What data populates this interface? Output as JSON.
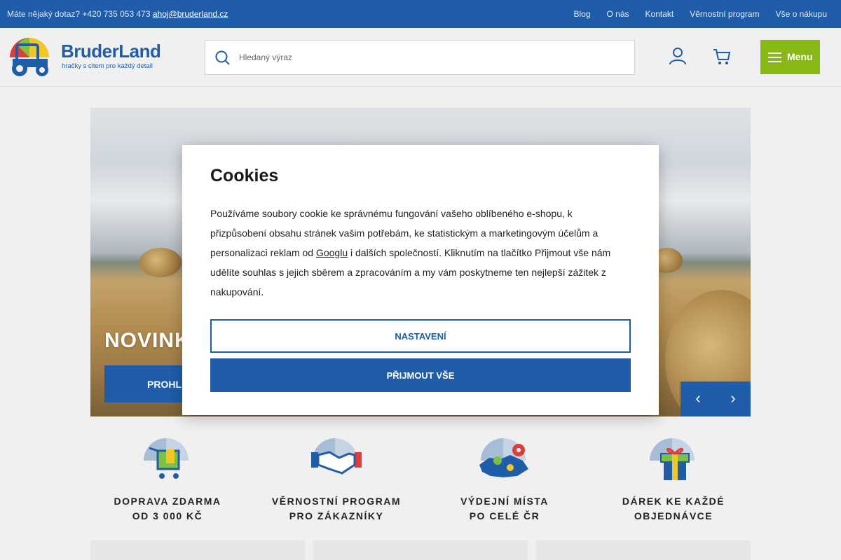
{
  "topbar": {
    "contact_text": "Máte nějaký dotaz? +420 735 053 473",
    "email": "ahoj@bruderland.cz",
    "links": [
      "Blog",
      "O nás",
      "Kontakt",
      "Věrnostní program",
      "Vše o nákupu"
    ]
  },
  "header": {
    "brand": "BruderLand",
    "tagline": "hračky s citem pro každý detail",
    "search_placeholder": "Hledaný výraz",
    "menu_label": "Menu"
  },
  "hero": {
    "title": "NOVINK",
    "cta_label": "PROHL"
  },
  "cookies": {
    "title": "Cookies",
    "text_before_link": "Používáme soubory cookie ke správnému fungování vašeho oblíbeného e-shopu, k přizpůsobení obsahu stránek vašim potřebám, ke statistickým a marketingovým účelům a personalizaci reklam od ",
    "link_text": "Googlu",
    "text_after_link": " i dalších společností. Kliknutím na tlačítko Přijmout vše nám udělíte souhlas s jejich sběrem a zpracováním a my vám poskytneme ten nejlepší zážitek z nakupování.",
    "settings_label": "NASTAVENÍ",
    "accept_label": "PŘIJMOUT VŠE"
  },
  "features": [
    {
      "line1": "DOPRAVA ZDARMA",
      "line2": "OD 3 000 KČ",
      "icon": "shopping-cart-icon"
    },
    {
      "line1": "VĚRNOSTNÍ PROGRAM",
      "line2": "PRO ZÁKAZNÍKY",
      "icon": "handshake-icon"
    },
    {
      "line1": "VÝDEJNÍ MÍSTA",
      "line2": "PO CELÉ ČR",
      "icon": "map-pin-icon"
    },
    {
      "line1": "DÁREK KE KAŽDÉ",
      "line2": "OBJEDNÁVCE",
      "icon": "gift-icon"
    }
  ],
  "colors": {
    "brand_blue": "#1f5da8",
    "menu_green": "#87b814"
  }
}
